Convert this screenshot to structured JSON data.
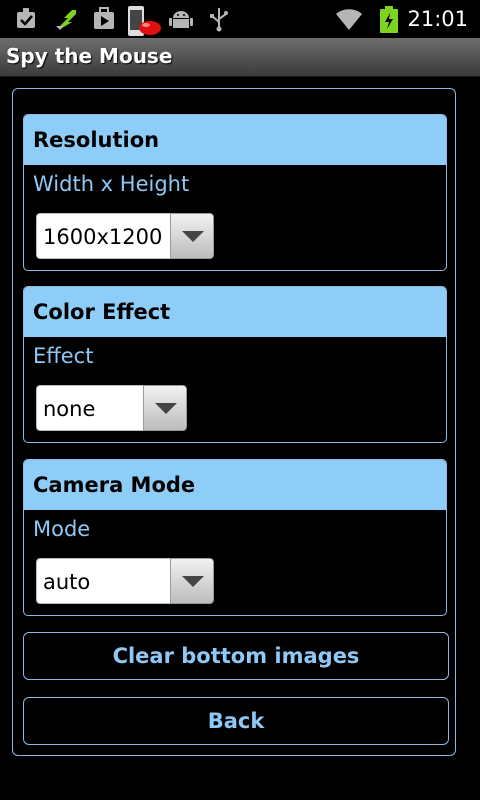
{
  "status_bar": {
    "time": "21:01",
    "icons": [
      "checkbox-icon",
      "sync-icon",
      "play-store-icon",
      "phone-notification-icon",
      "android-icon",
      "usb-icon",
      "wifi-icon",
      "battery-icon"
    ]
  },
  "app": {
    "title": "Spy the Mouse"
  },
  "sections": {
    "resolution": {
      "title": "Resolution",
      "subtitle": "Width x Height",
      "value": "1600x1200"
    },
    "color_effect": {
      "title": "Color Effect",
      "subtitle": "Effect",
      "value": "none"
    },
    "camera_mode": {
      "title": "Camera Mode",
      "subtitle": "Mode",
      "value": "auto"
    }
  },
  "buttons": {
    "clear": "Clear bottom images",
    "back": "Back"
  },
  "colors": {
    "accent": "#8fcdf9",
    "accent_text": "#8fc8f4",
    "title_bar": "#555555"
  }
}
